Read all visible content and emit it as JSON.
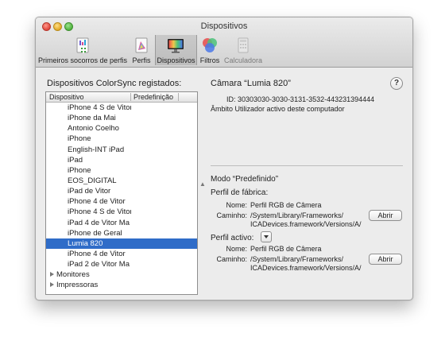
{
  "window": {
    "title": "Dispositivos"
  },
  "toolbar": {
    "items": [
      {
        "label": "Primeiros socorros de perfis",
        "icon": "first-aid-icon"
      },
      {
        "label": "Perfis",
        "icon": "profiles-icon"
      },
      {
        "label": "Dispositivos",
        "icon": "display-icon"
      },
      {
        "label": "Filtros",
        "icon": "filters-icon"
      },
      {
        "label": "Calculadora",
        "icon": "calculator-icon"
      }
    ]
  },
  "device_list": {
    "heading": "Dispositivos ColorSync registados:",
    "columns": [
      "Dispositivo",
      "Predefinição"
    ],
    "items": [
      "iPhone 4 S de Vitor",
      "iPhone da Mai",
      "Antonio Coelho",
      "iPhone",
      "English-INT iPad",
      "iPad",
      "iPhone",
      "EOS_DIGITAL",
      "iPad de Vitor",
      "iPhone 4 de Vitor",
      "iPhone 4 S de Vitor",
      "iPad 4 de Vitor Ma",
      "iPhone de Geral",
      "Lumia 820",
      "iPhone 4 de Vitor",
      "iPad 2 de Vitor Ma"
    ],
    "selected_index": 13,
    "groups": [
      "Monitores",
      "Impressoras"
    ]
  },
  "detail": {
    "camera_title": "Câmara “Lumia 820”",
    "help": "?",
    "id_line": "ID: 30303030-3030-3131-3532-443231394444",
    "scope": "Âmbito Utilizador activo deste computador",
    "mode": "Modo “Predefinido”",
    "factory_profile": {
      "heading": "Perfil de fábrica:",
      "name_label": "Nome:",
      "name": "Perfil RGB de Câmera",
      "path_label": "Caminho:",
      "path1": "/System/Library/Frameworks/",
      "path2": "ICADevices.framework/Versions/A/",
      "button": "Abrir"
    },
    "active_profile": {
      "heading": "Perfil activo:",
      "name_label": "Nome:",
      "name": "Perfil RGB de Câmera",
      "path_label": "Caminho:",
      "path1": "/System/Library/Frameworks/",
      "path2": "ICADevices.framework/Versions/A/",
      "button": "Abrir"
    }
  }
}
